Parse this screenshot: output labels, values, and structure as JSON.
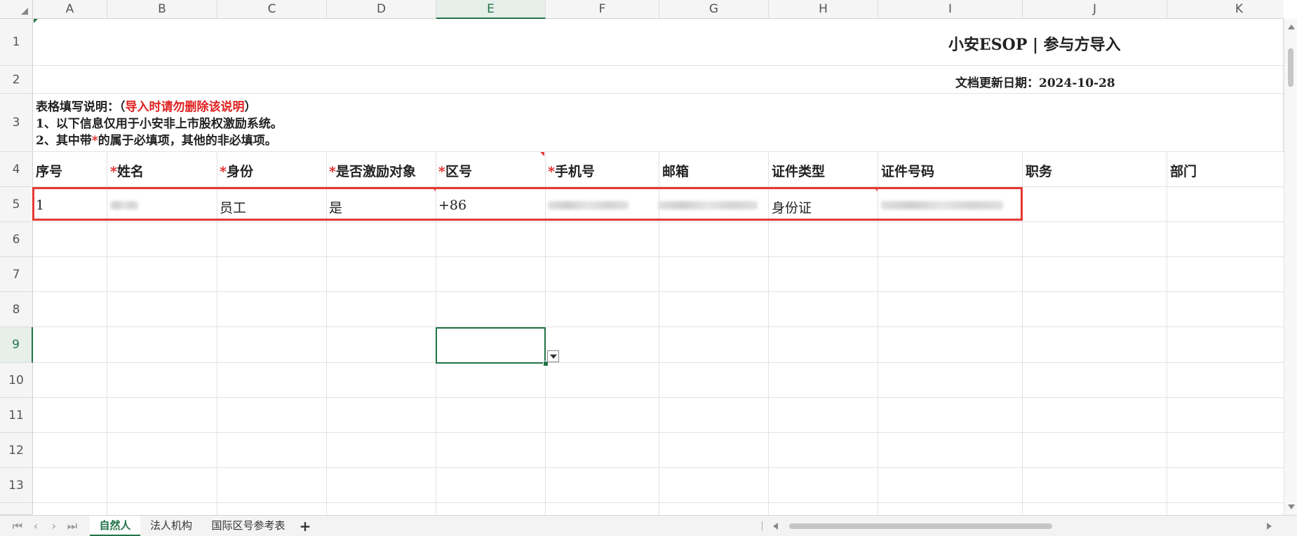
{
  "columns": [
    "A",
    "B",
    "C",
    "D",
    "E",
    "F",
    "G",
    "H",
    "I",
    "J",
    "K"
  ],
  "rows": [
    "1",
    "2",
    "3",
    "4",
    "5",
    "6",
    "7",
    "8",
    "9",
    "10",
    "11",
    "12",
    "13"
  ],
  "title": "小安ESOP | 参与方导入",
  "updated": "文档更新日期：2024-10-28",
  "notes": {
    "line1_prefix": "表格填写说明：（",
    "line1_red": "导入时请勿删除该说明",
    "line1_suffix": "）",
    "line2": "1、以下信息仅用于小安非上市股权激励系统。",
    "line3_prefix": "2、其中带",
    "line3_star": "*",
    "line3_suffix": "的属于必填项，其他的非必填项。"
  },
  "headers": [
    {
      "label": "序号",
      "required": false
    },
    {
      "label": "姓名",
      "required": true
    },
    {
      "label": "身份",
      "required": true
    },
    {
      "label": "是否激励对象",
      "required": true
    },
    {
      "label": "区号",
      "required": true
    },
    {
      "label": "手机号",
      "required": true
    },
    {
      "label": "邮箱",
      "required": false
    },
    {
      "label": "证件类型",
      "required": false
    },
    {
      "label": "证件号码",
      "required": false
    },
    {
      "label": "职务",
      "required": false
    },
    {
      "label": "部门",
      "required": false
    }
  ],
  "required_mark": "*",
  "row5": {
    "seq": "1",
    "identity": "员工",
    "is_incentive": "是",
    "area_code": "+86",
    "id_type": "身份证"
  },
  "selected_cell": "E9",
  "sheet_tabs": [
    "自然人",
    "法人机构",
    "国际区号参考表"
  ],
  "active_tab": "自然人",
  "add_tab": "+",
  "colors": {
    "accent": "#217346",
    "required": "#e02020",
    "highlight_box": "#e53935"
  }
}
